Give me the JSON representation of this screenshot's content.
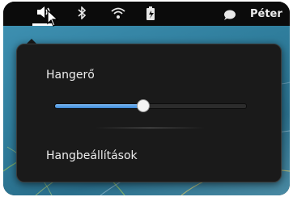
{
  "topbar": {
    "icons": [
      "speaker-icon",
      "bluetooth-icon",
      "wifi-icon",
      "battery-icon",
      "chat-icon"
    ],
    "user_name": "Péter"
  },
  "volume_menu": {
    "label": "Hangerő",
    "volume_fraction": 0.46,
    "settings_label": "Hangbeállítások"
  },
  "colors": {
    "accent": "#3a86d4",
    "menu_bg": "#1a1a1a",
    "wallpaper": "#2f7d9c"
  }
}
